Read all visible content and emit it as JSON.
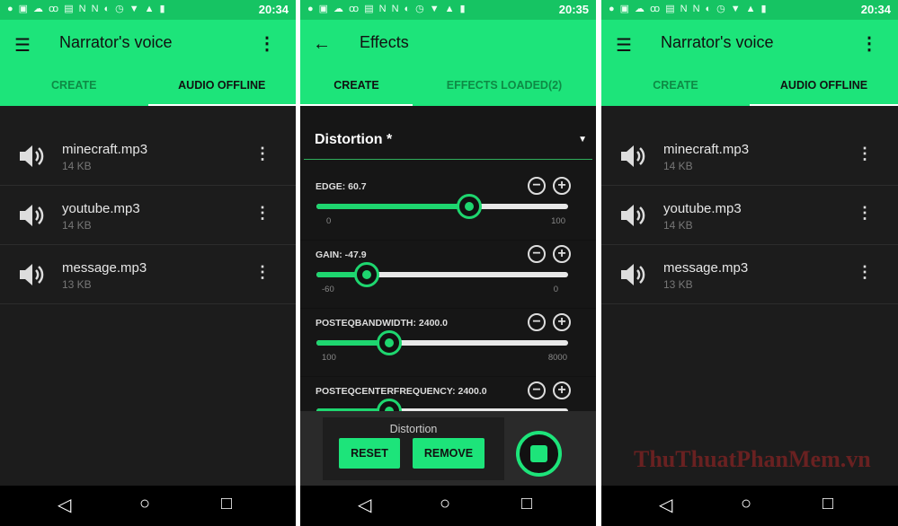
{
  "left": {
    "time": "20:34",
    "title": "Narrator's voice",
    "tabs": [
      "CREATE",
      "AUDIO OFFLINE"
    ],
    "files": [
      {
        "name": "minecraft.mp3",
        "size": "14 KB"
      },
      {
        "name": "youtube.mp3",
        "size": "14 KB"
      },
      {
        "name": "message.mp3",
        "size": "13 KB"
      }
    ]
  },
  "middle": {
    "time": "20:35",
    "title": "Effects",
    "tabs": [
      "CREATE",
      "EFFECTS LOADED(2)"
    ],
    "effect_select": "Distortion *",
    "sliders": [
      {
        "label": "EDGE: 60.7",
        "value": 60.7,
        "min": "0",
        "max": "100"
      },
      {
        "label": "GAIN: -47.9",
        "value": -47.9,
        "min": "-60",
        "max": "0"
      },
      {
        "label": "POSTEQBANDWIDTH: 2400.0",
        "value": 2400,
        "min": "100",
        "max": "8000"
      },
      {
        "label": "POSTEQCENTERFREQUENCY: 2400.0"
      }
    ],
    "sheet": {
      "caption": "Distortion",
      "reset": "RESET",
      "remove": "REMOVE"
    }
  },
  "right": {
    "time": "20:34",
    "title": "Narrator's voice",
    "tabs": [
      "CREATE",
      "AUDIO OFFLINE"
    ],
    "files": [
      {
        "name": "minecraft.mp3",
        "size": "14 KB"
      },
      {
        "name": "youtube.mp3",
        "size": "14 KB"
      },
      {
        "name": "message.mp3",
        "size": "13 KB"
      }
    ]
  },
  "watermark": "ThuThuatPhanMem.vn",
  "colors": {
    "accent": "#1de47a",
    "status": "#16c463",
    "background": "#1c1c1c"
  }
}
